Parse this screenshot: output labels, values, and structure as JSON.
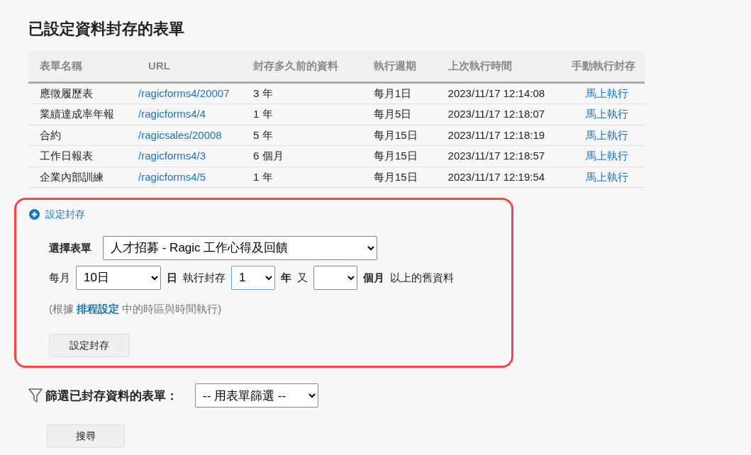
{
  "title": "已設定資料封存的表單",
  "table": {
    "columns": [
      "表單名稱",
      "URL",
      "封存多久前的資料",
      "執行週期",
      "上次執行時間",
      "手動執行封存"
    ],
    "rows": [
      {
        "name": "應徵履歷表",
        "url": "/ragicforms4/20007",
        "age": "3 年",
        "cycle": "每月1日",
        "last_run": "2023/11/17 12:14:08",
        "action": "馬上執行"
      },
      {
        "name": "業績達成率年報",
        "url": "/ragicforms4/4",
        "age": "1 年",
        "cycle": "每月5日",
        "last_run": "2023/11/17 12:18:07",
        "action": "馬上執行"
      },
      {
        "name": "合約",
        "url": "/ragicsales/20008",
        "age": "5 年",
        "cycle": "每月15日",
        "last_run": "2023/11/17 12:18:19",
        "action": "馬上執行"
      },
      {
        "name": "工作日報表",
        "url": "/ragicforms4/3",
        "age": "6 個月",
        "cycle": "每月15日",
        "last_run": "2023/11/17 12:18:57",
        "action": "馬上執行"
      },
      {
        "name": "企業內部訓練",
        "url": "/ragicforms4/5",
        "age": "1 年",
        "cycle": "每月15日",
        "last_run": "2023/11/17 12:19:54",
        "action": "馬上執行"
      }
    ]
  },
  "setup": {
    "toggle": "設定封存",
    "highlighted": true,
    "form_label": "選擇表單",
    "form_value": "人才招募 - Ragic 工作心得及回饋",
    "schedule": [
      {
        "kind": "text",
        "text": "每月",
        "bold": false
      },
      {
        "kind": "day_select",
        "value": "10日",
        "focused": false
      },
      {
        "kind": "text",
        "text": "日",
        "bold": true
      },
      {
        "kind": "text",
        "text": "執行封存",
        "bold": false
      },
      {
        "kind": "select",
        "value": "1",
        "focused": true
      },
      {
        "kind": "text",
        "text": "年",
        "bold": true
      },
      {
        "kind": "text",
        "text": "又",
        "bold": false
      },
      {
        "kind": "select",
        "focused": false
      },
      {
        "kind": "text",
        "text": "個月",
        "bold": true
      },
      {
        "kind": "text",
        "text": "以上的舊資料",
        "bold": false
      }
    ],
    "note": {
      "before": "(根據",
      "link": "排程設定",
      "after": "中的時區與時間執行)"
    },
    "button": "設定封存"
  },
  "filter": {
    "label": "篩選已封存資料的表單：",
    "value": "-- 用表單篩選 --",
    "button": "搜尋"
  }
}
